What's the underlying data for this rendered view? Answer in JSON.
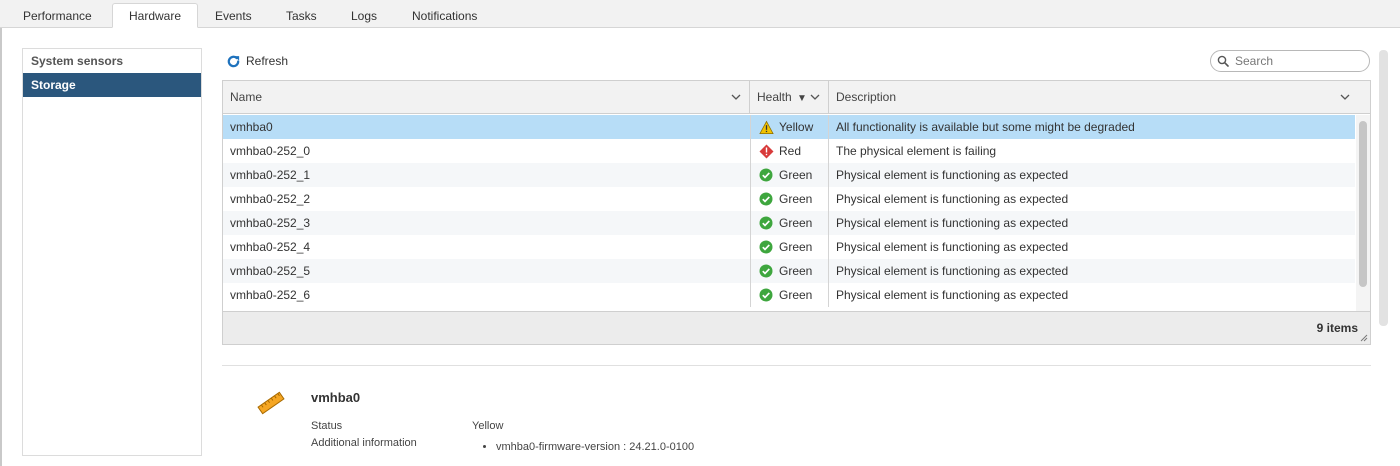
{
  "tabs": [
    {
      "label": "Performance",
      "active": false
    },
    {
      "label": "Hardware",
      "active": true
    },
    {
      "label": "Events",
      "active": false
    },
    {
      "label": "Tasks",
      "active": false
    },
    {
      "label": "Logs",
      "active": false
    },
    {
      "label": "Notifications",
      "active": false
    }
  ],
  "sidebar": {
    "items": [
      {
        "label": "System sensors",
        "active": false
      },
      {
        "label": "Storage",
        "active": true
      }
    ]
  },
  "toolbar": {
    "refresh_label": "Refresh",
    "search_placeholder": "Search"
  },
  "grid": {
    "columns": {
      "name": "Name",
      "health": "Health",
      "description": "Description"
    },
    "health_sort_indicator": "▼",
    "rows": [
      {
        "name": "vmhba0",
        "status": "warning",
        "health": "Yellow",
        "description": "All functionality is available but some might be degraded",
        "selected": true
      },
      {
        "name": "vmhba0-252_0",
        "status": "error",
        "health": "Red",
        "description": "The physical element is failing",
        "selected": false
      },
      {
        "name": "vmhba0-252_1",
        "status": "ok",
        "health": "Green",
        "description": "Physical element is functioning as expected",
        "selected": false
      },
      {
        "name": "vmhba0-252_2",
        "status": "ok",
        "health": "Green",
        "description": "Physical element is functioning as expected",
        "selected": false
      },
      {
        "name": "vmhba0-252_3",
        "status": "ok",
        "health": "Green",
        "description": "Physical element is functioning as expected",
        "selected": false
      },
      {
        "name": "vmhba0-252_4",
        "status": "ok",
        "health": "Green",
        "description": "Physical element is functioning as expected",
        "selected": false
      },
      {
        "name": "vmhba0-252_5",
        "status": "ok",
        "health": "Green",
        "description": "Physical element is functioning as expected",
        "selected": false
      },
      {
        "name": "vmhba0-252_6",
        "status": "ok",
        "health": "Green",
        "description": "Physical element is functioning as expected",
        "selected": false
      }
    ],
    "footer_count": "9 items"
  },
  "details": {
    "icon": "storage-adapter-icon",
    "title": "vmhba0",
    "status_label": "Status",
    "status_value": "Yellow",
    "additional_label": "Additional information",
    "additional_items": [
      "vmhba0-firmware-version : 24.21.0-0100"
    ]
  },
  "colors": {
    "sidebar_active": "#2b577d",
    "row_selected": "#b7ddf7",
    "warning": "#f2c200",
    "error": "#d83b3b",
    "ok": "#3ea63e",
    "refresh_icon": "#1e72bd"
  }
}
